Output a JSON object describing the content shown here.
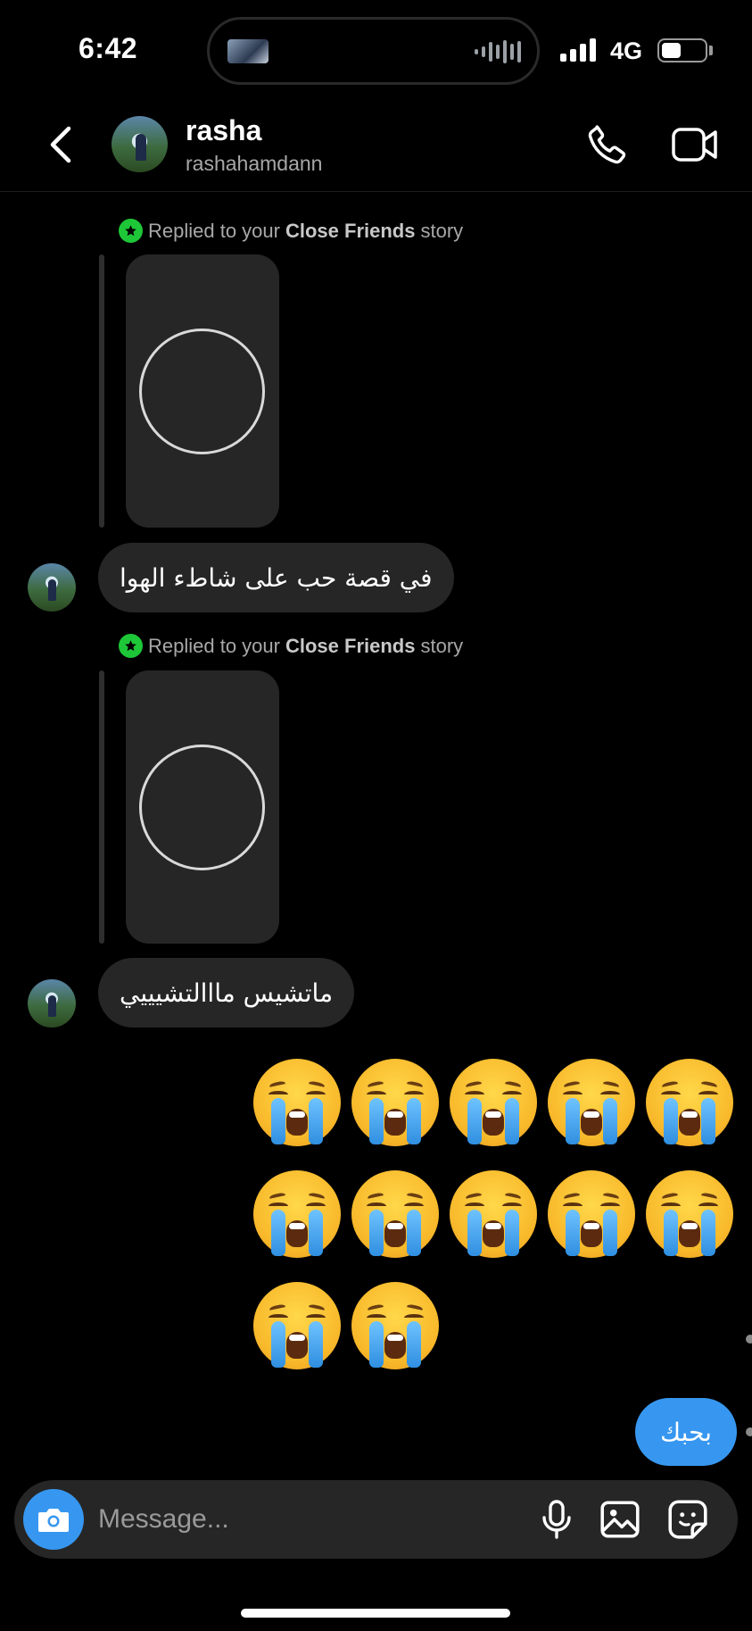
{
  "status_bar": {
    "time": "6:42",
    "network": "4G",
    "battery_level": 0.45
  },
  "header": {
    "name": "rasha",
    "username": "rashahamdann"
  },
  "messages": [
    {
      "type": "story_reply",
      "note_prefix": "Replied to your",
      "note_bold": "Close Friends",
      "note_suffix": "story",
      "text": "في قصة حب على شاطء الهوا"
    },
    {
      "type": "story_reply",
      "note_prefix": "Replied to your",
      "note_bold": "Close Friends",
      "note_suffix": "story",
      "text": "ماتشيس مااالتشيييي"
    }
  ],
  "emoji_message": {
    "emoji": "loudly-crying-face",
    "count": 12
  },
  "outgoing_text": "بحبك",
  "composer": {
    "placeholder": "Message..."
  },
  "colors": {
    "accent_blue": "#3797f0",
    "close_friends_green": "#1ec737",
    "bubble_gray": "#262626"
  }
}
